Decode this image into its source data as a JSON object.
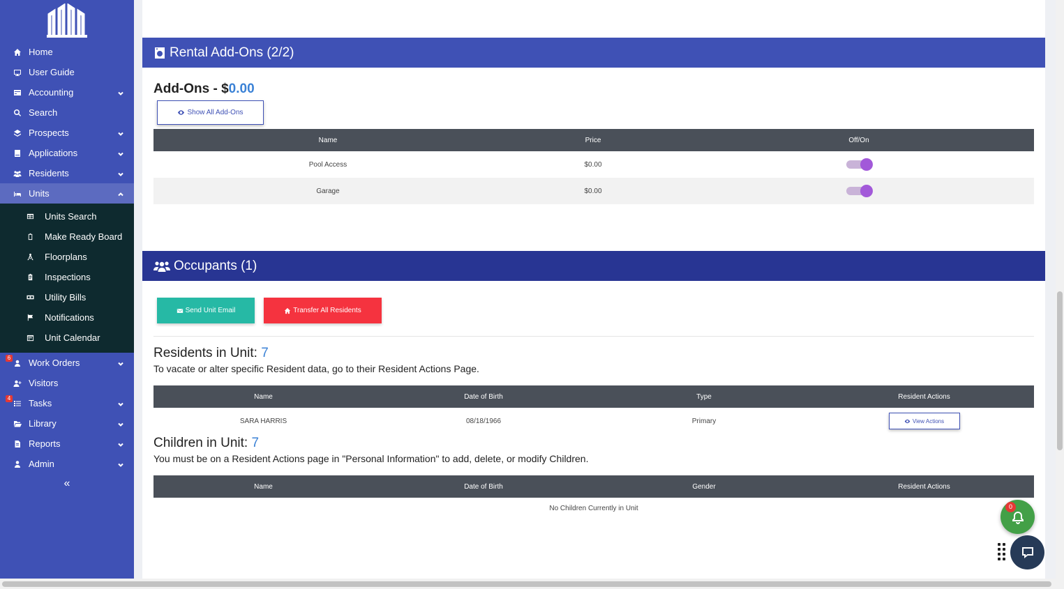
{
  "sidebar": {
    "items": [
      {
        "label": "Home"
      },
      {
        "label": "User Guide"
      },
      {
        "label": "Accounting"
      },
      {
        "label": "Search"
      },
      {
        "label": "Prospects"
      },
      {
        "label": "Applications"
      },
      {
        "label": "Residents"
      },
      {
        "label": "Units"
      }
    ],
    "units_sub": [
      {
        "label": "Units Search"
      },
      {
        "label": "Make Ready Board"
      },
      {
        "label": "Floorplans"
      },
      {
        "label": "Inspections"
      },
      {
        "label": "Utility Bills"
      },
      {
        "label": "Notifications"
      },
      {
        "label": "Unit Calendar"
      }
    ],
    "items_after": [
      {
        "label": "Work Orders",
        "badge": "6"
      },
      {
        "label": "Visitors"
      },
      {
        "label": "Tasks",
        "badge": "4"
      },
      {
        "label": "Library"
      },
      {
        "label": "Reports"
      },
      {
        "label": "Admin"
      }
    ],
    "collapse": "«"
  },
  "addons": {
    "header": "Rental Add-Ons (2/2)",
    "title_prefix": "Add-Ons - $",
    "amount": "0.00",
    "show_all_label": "Show All Add-Ons",
    "columns": [
      "Name",
      "Price",
      "Off/On"
    ],
    "rows": [
      {
        "name": "Pool Access",
        "price": "$0.00",
        "on": true
      },
      {
        "name": "Garage",
        "price": "$0.00",
        "on": true
      }
    ]
  },
  "occupants": {
    "header": "Occupants (1)",
    "send_email_label": "Send Unit Email",
    "transfer_label": "Transfer All Residents",
    "residents_title": "Residents in Unit: ",
    "residents_count": "7",
    "residents_note": "To vacate or alter specific Resident data, go to their Resident Actions Page.",
    "residents_columns": [
      "Name",
      "Date of Birth",
      "Type",
      "Resident Actions"
    ],
    "residents_rows": [
      {
        "name": "SARA HARRIS",
        "dob": "08/18/1966",
        "type": "Primary",
        "action": "View Actions"
      }
    ],
    "children_title": "Children in Unit: ",
    "children_count": "7",
    "children_note": "You must be on a Resident Actions page in \"Personal Information\" to add, delete, or modify Children.",
    "children_columns": [
      "Name",
      "Date of Birth",
      "Gender",
      "Resident Actions"
    ],
    "children_empty": "No Children Currently in Unit"
  },
  "notifications": {
    "count": "0"
  },
  "colors": {
    "primary": "#3f51b5",
    "header_dark": "#283593",
    "teal": "#26b9a5",
    "red": "#f5333f",
    "accent_number": "#3b82d6",
    "toggle_on": "#a259d9"
  }
}
